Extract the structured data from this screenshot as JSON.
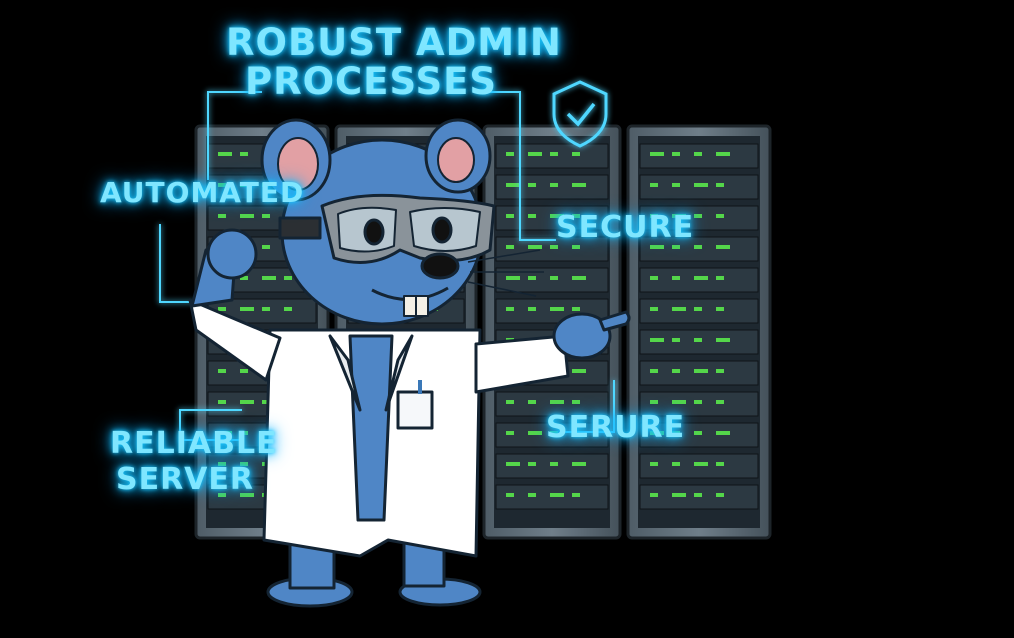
{
  "labels": {
    "title_line1": "ROBUST ADMIN",
    "title_line2": "PROCESSES",
    "automated": "AUTOMATED",
    "secure": "SECURE",
    "serure": "SERURE",
    "reliable_line1": "RELIABLE",
    "reliable_line2": "SERVER"
  },
  "colors": {
    "background": "#000000",
    "glow_text": "#7fe6ff",
    "mouse_fur": "#4f86c6",
    "server_led": "#54d64a",
    "lab_coat": "#ffffff"
  },
  "icons": [
    "shield-check-icon"
  ]
}
